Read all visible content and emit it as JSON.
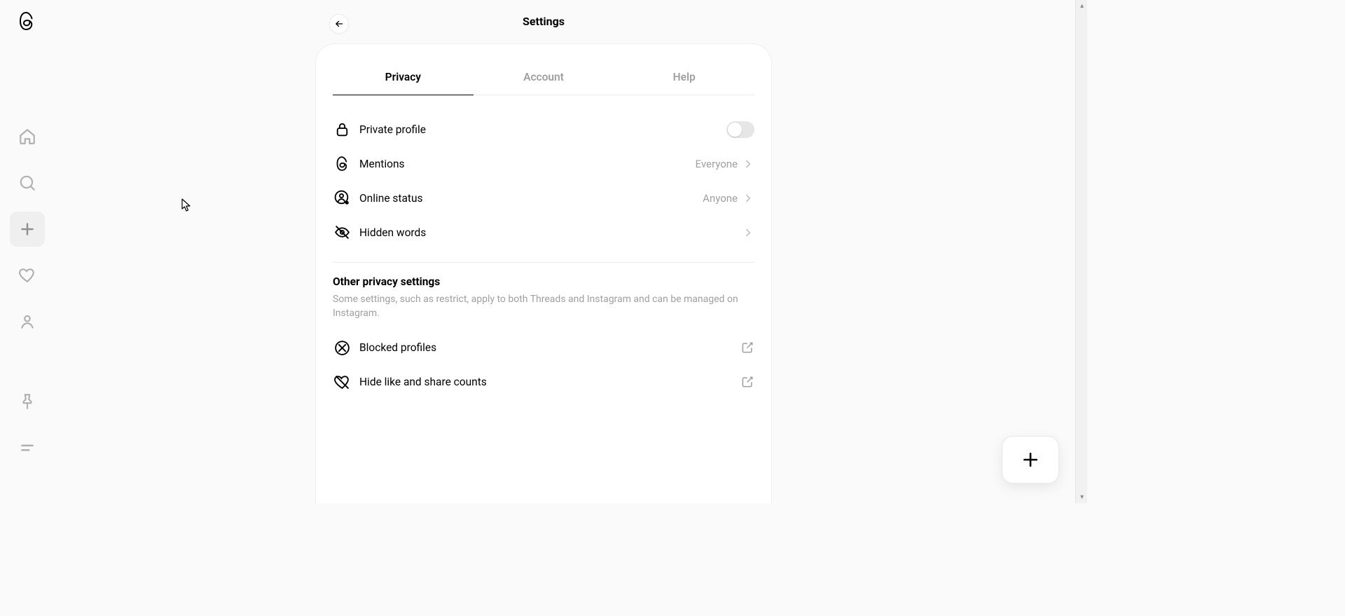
{
  "header": {
    "title": "Settings"
  },
  "tabs": {
    "privacy": "Privacy",
    "account": "Account",
    "help": "Help",
    "active": "privacy"
  },
  "privacy": {
    "private_profile": {
      "label": "Private profile",
      "on": false
    },
    "mentions": {
      "label": "Mentions",
      "value": "Everyone"
    },
    "online_status": {
      "label": "Online status",
      "value": "Anyone"
    },
    "hidden_words": {
      "label": "Hidden words"
    },
    "other_header": "Other privacy settings",
    "other_desc": "Some settings, such as restrict, apply to both Threads and Instagram and can be managed on Instagram.",
    "blocked": {
      "label": "Blocked profiles"
    },
    "hide_counts": {
      "label": "Hide like and share counts"
    }
  }
}
